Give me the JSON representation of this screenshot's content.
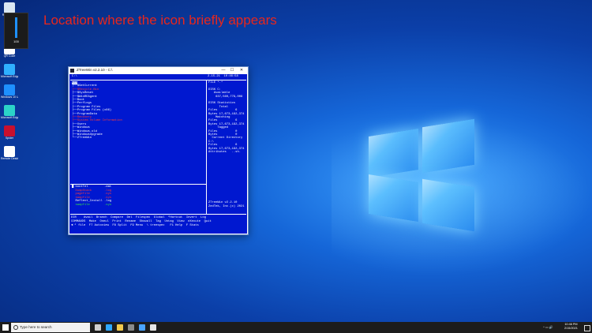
{
  "annotation": "Location where the icon briefly appears",
  "volume": {
    "level": "100",
    "level_fraction": 1.0
  },
  "desktop_icons": [
    {
      "label": "Recycle Bin",
      "icon": "recycle-bin-icon",
      "color": "#d9e6f2"
    },
    {
      "label": "Volume",
      "icon": "volume-app-icon",
      "color": "#ffffff"
    },
    {
      "label": "QR Code",
      "icon": "qr-icon",
      "color": "#ffffff"
    },
    {
      "label": "Microsoft Edge",
      "icon": "edge-icon",
      "color": "#2fb0ff"
    },
    {
      "label": "Windows 10 Update Asst.",
      "icon": "windows-icon",
      "color": "#1e90ff"
    },
    {
      "label": "Microsoft Edge Beta",
      "icon": "edge-beta-icon",
      "color": "#2bd4c8"
    },
    {
      "label": "Spider",
      "icon": "spider-icon",
      "color": "#c8102e"
    },
    {
      "label": "Remote Desktop",
      "icon": "panda-icon",
      "color": "#ffffff"
    }
  ],
  "ztree": {
    "title": "ZTreeWin v2.2.10 - C:\\",
    "path": "C:\\",
    "datetime": "2-15-21  10:46:58",
    "tree": [
      {
        "text": "C:\\",
        "color": "hl"
      },
      {
        "text": "├──$GetCurrent",
        "color": "white"
      },
      {
        "text": "├──$Recycle.Bin",
        "color": "red"
      },
      {
        "text": "├──$SysReset",
        "color": "white"
      },
      {
        "text": "├──$WinREAgent",
        "color": "white"
      },
      {
        "text": "├──Boot",
        "color": "white"
      },
      {
        "text": "├──PerfLogs",
        "color": "white"
      },
      {
        "text": "├──Program Files",
        "color": "white"
      },
      {
        "text": "├──Program Files (x86)",
        "color": "white"
      },
      {
        "text": "├──ProgramData",
        "color": "white"
      },
      {
        "text": "├──Recovery",
        "color": "red"
      },
      {
        "text": "├──System Volume Information",
        "color": "red"
      },
      {
        "text": "├──Users",
        "color": "white"
      },
      {
        "text": "├──Windows",
        "color": "white"
      },
      {
        "text": "├──Windows.old",
        "color": "white"
      },
      {
        "text": "├──WindowsUpgrade",
        "color": "white"
      },
      {
        "text": "└──ZTreeWin",
        "color": "white"
      }
    ],
    "right_panel": [
      {
        "text": "FILE *.*",
        "color": "white"
      },
      {
        "text": "",
        "color": "white"
      },
      {
        "text": "DISK C:",
        "color": "white"
      },
      {
        "text": "   Available",
        "color": "white"
      },
      {
        "text": "    637,560,779,008",
        "color": "white"
      },
      {
        "text": "",
        "color": "white"
      },
      {
        "text": "DISK Statistics",
        "color": "white"
      },
      {
        "text": "      Total",
        "color": "white"
      },
      {
        "text": "Files          6",
        "color": "white"
      },
      {
        "text": "Bytes 17,673,192,374",
        "color": "white"
      },
      {
        "text": "    Matching",
        "color": "white"
      },
      {
        "text": "Files          6",
        "color": "white"
      },
      {
        "text": "Bytes 17,673,192,374",
        "color": "white"
      },
      {
        "text": "     Tagged",
        "color": "white"
      },
      {
        "text": "Files          0",
        "color": "white"
      },
      {
        "text": "Bytes          0",
        "color": "white"
      },
      {
        "text": "  Current Directory",
        "color": "white"
      },
      {
        "text": "C:\\",
        "color": "white"
      },
      {
        "text": "Files          6",
        "color": "white"
      },
      {
        "text": "Bytes 17,673,192,374",
        "color": "white"
      },
      {
        "text": "Attributes   ..sh.",
        "color": "white"
      }
    ],
    "files": [
      {
        "text": "█ bootTel         .dat",
        "color": "white"
      },
      {
        "text": "  DumpStack       .log",
        "color": "red"
      },
      {
        "text": "  pagefile        .sys",
        "color": "red"
      },
      {
        "text": "  swapfile        .sys",
        "color": "red"
      },
      {
        "text": "  Reflect_Install .log",
        "color": "white"
      },
      {
        "text": "  swapfile        .sys",
        "color": "green"
      }
    ],
    "version_lines": [
      "ZTreeWin v2.2.10",
      "ZedTek, Inc.(c) 2021"
    ],
    "command_lines": [
      "DIR    Avail  Branch  Compare  Del  Filespec  Global  ^Hortcut  Invert  Log",
      "COMMANDS  Make  Oneul  Print  Rename  Showall  Tag  Untag  View  eXecute  Quit",
      "◄ ┘ file  F7 Autoview  F8 Split  F9 Menu  \\ treespec   F1 Help  F Stats"
    ]
  },
  "taskbar": {
    "search_placeholder": "Type here to search",
    "apps": [
      "task-view-icon",
      "edge-icon",
      "file-explorer-icon",
      "store-icon",
      "mail-icon",
      "ztree-icon"
    ],
    "tray": "^ ▭ 🔊",
    "time": "10:46 PM",
    "date": "2/15/2021"
  }
}
